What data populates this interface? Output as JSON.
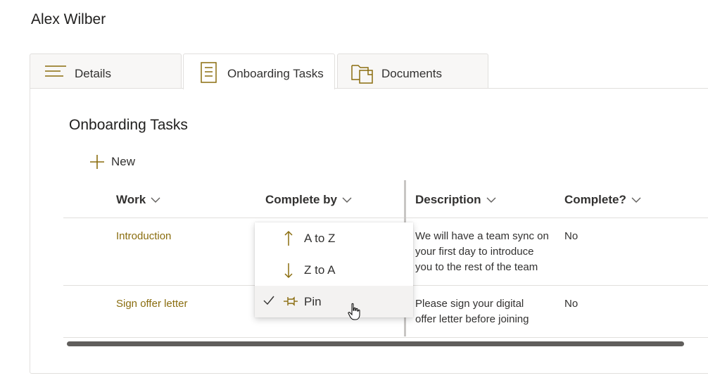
{
  "person": {
    "name": "Alex Wilber"
  },
  "tabs": [
    {
      "label": "Details",
      "icon": "details-lines-icon",
      "active": false
    },
    {
      "label": "Onboarding Tasks",
      "icon": "task-list-icon",
      "active": true
    },
    {
      "label": "Documents",
      "icon": "documents-folder-icon",
      "active": false
    }
  ],
  "list": {
    "title": "Onboarding Tasks",
    "new_label": "New",
    "columns": [
      {
        "label": "Work"
      },
      {
        "label": "Complete by"
      },
      {
        "label": "Description"
      },
      {
        "label": "Complete?"
      }
    ],
    "rows": [
      {
        "work": "Introduction",
        "complete_by": "",
        "description": [
          "We will have a team sync on",
          "your first day to introduce",
          "you to the rest of the team"
        ],
        "complete": "No"
      },
      {
        "work": "Sign offer letter",
        "complete_by": "",
        "description": [
          "Please sign your digital",
          "offer letter before joining"
        ],
        "complete": "No"
      }
    ]
  },
  "column_menu": {
    "items": [
      {
        "label": "A to Z",
        "icon": "arrow-up-icon",
        "checked": false
      },
      {
        "label": "Z to A",
        "icon": "arrow-down-icon",
        "checked": false
      },
      {
        "label": "Pin",
        "icon": "pin-icon",
        "checked": true
      }
    ]
  },
  "colors": {
    "accent": "#8a6d0f",
    "link": "#8a6d0f",
    "text": "#323130"
  }
}
